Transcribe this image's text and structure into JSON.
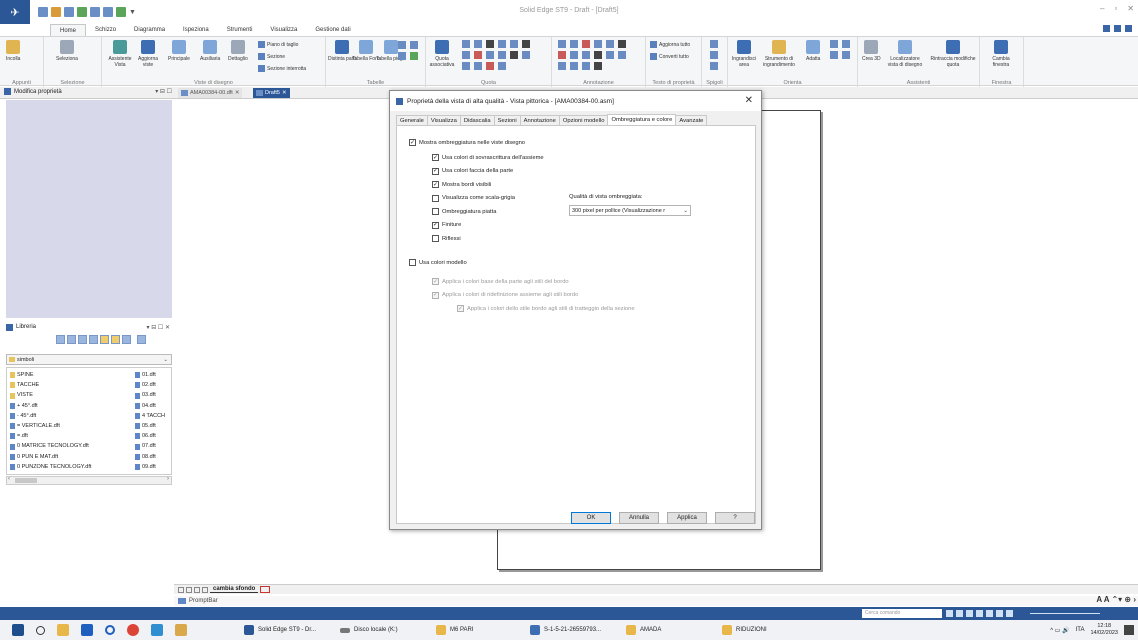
{
  "window": {
    "title": "Solid Edge ST9 - Draft - [Draft5]"
  },
  "menu": {
    "tabs": [
      "Home",
      "Schizzo",
      "Diagramma",
      "Ispeziona",
      "Strumenti",
      "Visualizza",
      "Gestione dati"
    ],
    "active": "Home"
  },
  "ribbon": {
    "groups": {
      "appunti": "Appunti",
      "selezione": "Selezione",
      "viste": "Viste di disegno",
      "tabelle": "Tabelle",
      "quota": "Quota",
      "annotazione": "Annotazione",
      "testo": "Testo di proprietà",
      "spigoli": "Spigoli",
      "orienta": "Orienta",
      "assistenti": "Assistenti",
      "finestra": "Finestra"
    },
    "buttons": {
      "incolla": "Incolla",
      "seleziona": "Seleziona",
      "assistente_vista": "Assistente Vista",
      "aggiorna_viste": "Aggiorna viste",
      "principale": "Principale",
      "ausiliaria": "Ausiliaria",
      "dettaglio": "Dettaglio",
      "piano_taglio": "Piano di taglio",
      "sezione": "Sezione",
      "sezione_interrotta": "Sezione interrotta",
      "distinta_parti": "Distinta parti",
      "tabella_foro": "Tabella Foro",
      "tabella_piega": "Tabella piega",
      "quota_associativa": "Quota associativa",
      "aggiorna_tutto": "Aggiorna tutto",
      "converti_tutto": "Converti tutto",
      "ingrandisci_area": "Ingrandisci area",
      "strumento_ingrandimento": "Strumento di ingrandimento",
      "adatta": "Adatta",
      "crea_3d": "Crea 3D",
      "localizzatore": "Localizzatore vista di disegno",
      "rintraccia": "Rintraccia modifiche quota",
      "cambia_finestra": "Cambia finestra"
    }
  },
  "panels": {
    "properties": "Modifica proprietà",
    "library": "Libreria",
    "folder": "simboli"
  },
  "doc_tabs": {
    "inactive": "AMA00384-00.dft",
    "active": "Draft5"
  },
  "library": {
    "col1": [
      {
        "name": "SPINE",
        "type": "folder"
      },
      {
        "name": "TACCHE",
        "type": "folder"
      },
      {
        "name": "VISTE",
        "type": "folder"
      },
      {
        "name": "+ 45°.dft",
        "type": "doc"
      },
      {
        "name": "- 45°.dft",
        "type": "doc"
      },
      {
        "name": "= VERTICALE.dft",
        "type": "doc"
      },
      {
        "name": "=.dft",
        "type": "doc"
      },
      {
        "name": "0 MATRICE TECNOLOGY.dft",
        "type": "doc"
      },
      {
        "name": "0 PUN E MAT.dft",
        "type": "doc"
      },
      {
        "name": "0 PUNZONE TECNOLOGY.dft",
        "type": "doc"
      }
    ],
    "col2": [
      "01.dft",
      "02.dft",
      "03.dft",
      "04.dft",
      "4 TACCH",
      "05.dft",
      "06.dft",
      "07.dft",
      "08.dft",
      "09.dft"
    ]
  },
  "sheet_tab": "cambia sfondo",
  "prompt": "PromptBar",
  "status": {
    "command_placeholder": "Cerca comando"
  },
  "dialog": {
    "title": "Proprietà della vista di alta qualità - Vista pittorica - [AMA00384-00.asm]",
    "tabs": [
      "Generale",
      "Visualizza",
      "Didascalia",
      "Sezioni",
      "Annotazione",
      "Opzioni modello",
      "Ombreggiatura e colore",
      "Avanzate"
    ],
    "active_tab": "Ombreggiatura e colore",
    "show_shading": {
      "label": "Mostra ombreggiatura nelle viste disegno",
      "checked": true
    },
    "options": [
      {
        "label": "Usa colori di sovrascrittura dell'assieme",
        "checked": true
      },
      {
        "label": "Usa colori faccia della parte",
        "checked": true
      },
      {
        "label": "Mostra bordi visibili",
        "checked": true
      },
      {
        "label": "Visualizza come scala-grigia",
        "checked": false
      },
      {
        "label": "Ombreggiatura piatta",
        "checked": false
      },
      {
        "label": "Finiture",
        "checked": true
      },
      {
        "label": "Riflessi",
        "checked": false
      }
    ],
    "quality_label": "Qualità di vista ombreggiata:",
    "quality_value": "300 pixel per pollice (Visualizzazione r",
    "model_colors": {
      "label": "Usa colori modello",
      "checked": false
    },
    "model_options": [
      {
        "label": "Applica i colori base della parte agli stili del bordo",
        "checked": true
      },
      {
        "label": "Applica i colori di ridefinizione assieme agli stili bordo",
        "checked": true
      },
      {
        "label": "Applica i colori dello stile bordo agli stili di tratteggio della sezione",
        "checked": true
      }
    ],
    "buttons": {
      "ok": "OK",
      "cancel": "Annulla",
      "apply": "Applica",
      "help": "?"
    }
  },
  "taskbar": {
    "items": [
      "Solid Edge ST9 - Dr...",
      "Disco locale (K:)",
      "M6 PARI",
      "S-1-5-21-26559793...",
      "AMADA",
      "RIDUZIONI"
    ],
    "lang": "ITA",
    "time": "12:18",
    "date": "14/02/2023"
  }
}
